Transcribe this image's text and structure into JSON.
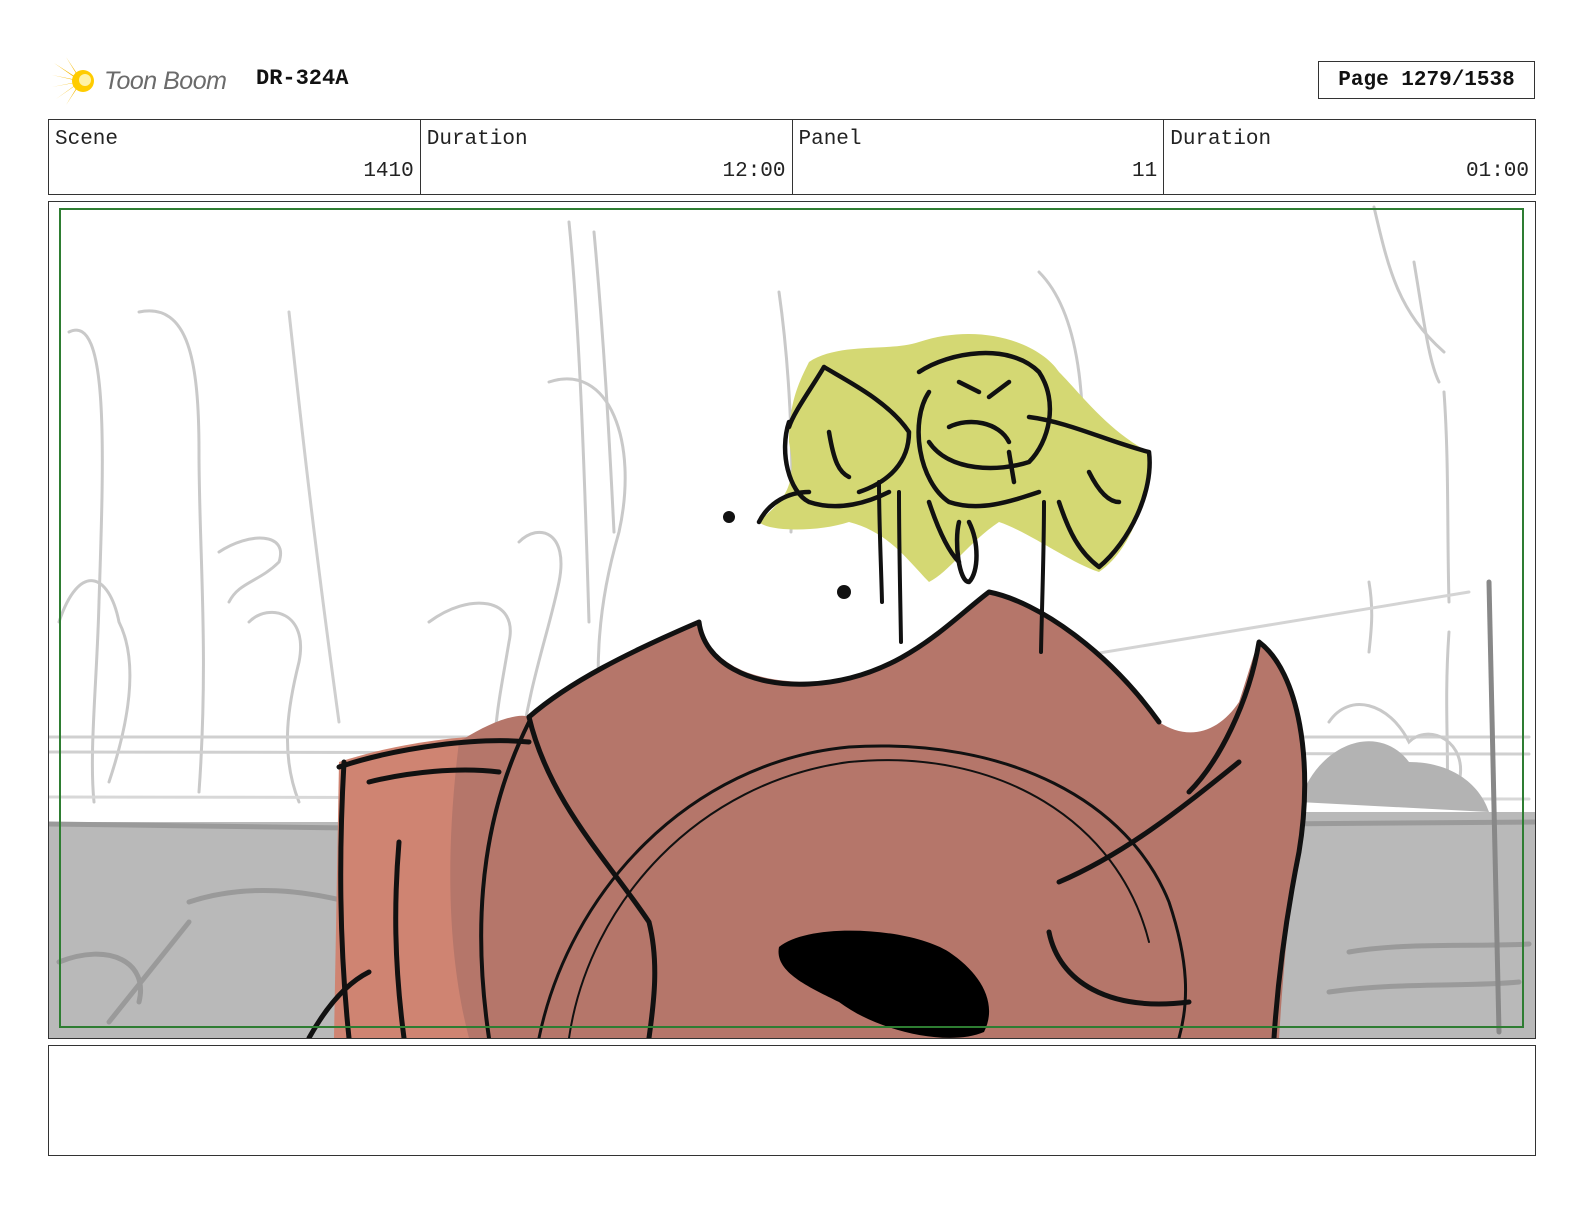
{
  "header": {
    "logo_text": "Toon Boom",
    "sheet_code": "DR-324A",
    "page_label": "Page 1279/1538"
  },
  "info": {
    "scene_label": "Scene",
    "scene_value": "1410",
    "scene_duration_label": "Duration",
    "scene_duration_value": "12:00",
    "panel_label": "Panel",
    "panel_value": "11",
    "panel_duration_label": "Duration",
    "panel_duration_value": "01:00"
  },
  "colors": {
    "safe_frame": "#2e7d32",
    "character_body": "#b5766a",
    "character_light": "#cf8472",
    "creature": "#d4d873",
    "ground": "#b9b9b9",
    "sketch_line": "#c8c8c8"
  },
  "notes": {
    "text": ""
  }
}
